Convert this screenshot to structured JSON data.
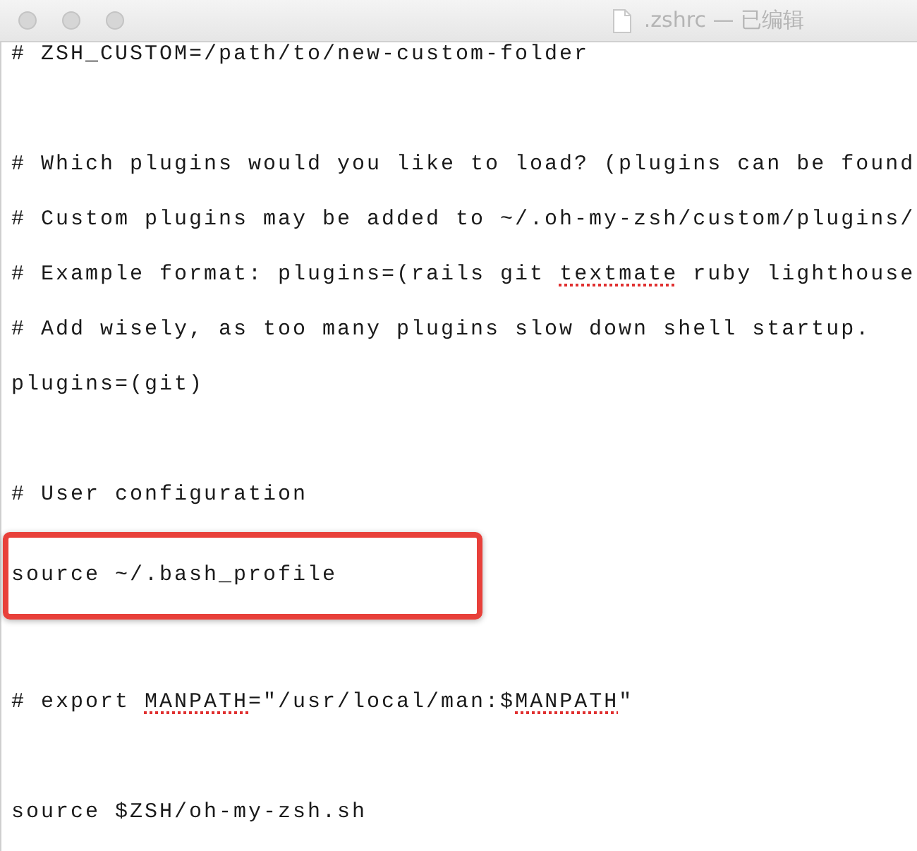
{
  "window": {
    "title": ".zshrc — 已编辑"
  },
  "lines": [
    {
      "kind": "text",
      "highlighted": false,
      "segments": [
        {
          "text": "# ZSH_CUSTOM=/path/to/new-custom-folder",
          "misspelled": false
        }
      ]
    },
    {
      "kind": "blank"
    },
    {
      "kind": "text",
      "highlighted": false,
      "segments": [
        {
          "text": "# Which plugins would you like to load? (plugins can be found",
          "misspelled": false
        }
      ]
    },
    {
      "kind": "text",
      "highlighted": false,
      "segments": [
        {
          "text": "# Custom plugins may be added to ~/.oh-my-zsh/custom/plugins/",
          "misspelled": false
        }
      ]
    },
    {
      "kind": "text",
      "highlighted": false,
      "segments": [
        {
          "text": "# Example format: plugins=(rails git ",
          "misspelled": false
        },
        {
          "text": "textmate",
          "misspelled": true
        },
        {
          "text": " ruby lighthouse",
          "misspelled": false
        }
      ]
    },
    {
      "kind": "text",
      "highlighted": false,
      "segments": [
        {
          "text": "# Add wisely, as too many plugins slow down shell startup.",
          "misspelled": false
        }
      ]
    },
    {
      "kind": "text",
      "highlighted": false,
      "segments": [
        {
          "text": "plugins=(git)",
          "misspelled": false
        }
      ]
    },
    {
      "kind": "blank"
    },
    {
      "kind": "text",
      "highlighted": false,
      "segments": [
        {
          "text": "# User configuration",
          "misspelled": false
        }
      ]
    },
    {
      "kind": "text",
      "highlighted": true,
      "segments": [
        {
          "text": "source ~/.bash_profile",
          "misspelled": false
        }
      ]
    },
    {
      "kind": "blank"
    },
    {
      "kind": "text",
      "highlighted": false,
      "segments": [
        {
          "text": "# export ",
          "misspelled": false
        },
        {
          "text": "MANPATH",
          "misspelled": true
        },
        {
          "text": "=\"/usr/local/man:$",
          "misspelled": false
        },
        {
          "text": "MANPATH",
          "misspelled": true
        },
        {
          "text": "\"",
          "misspelled": false
        }
      ]
    },
    {
      "kind": "blank"
    },
    {
      "kind": "text",
      "highlighted": false,
      "segments": [
        {
          "text": "source $ZSH/oh-my-zsh.sh",
          "misspelled": false
        }
      ]
    }
  ]
}
